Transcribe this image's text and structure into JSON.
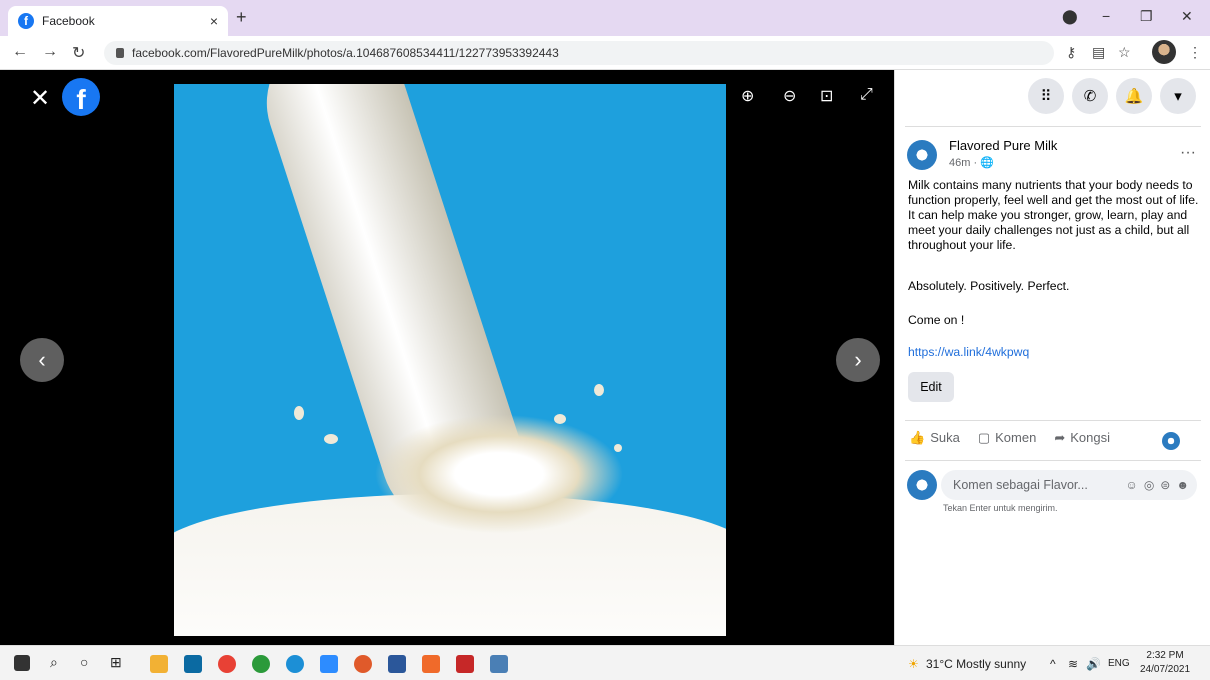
{
  "browser": {
    "tab_title": "Facebook",
    "tab_close": "×",
    "new_tab": "+",
    "url": "facebook.com/FlavoredPureMilk/photos/a.104687608534411/122773953392443",
    "window_minimize": "−",
    "window_restore": "❐",
    "window_close": "✕"
  },
  "viewer": {
    "close_label": "✕",
    "fb_logo": "f"
  },
  "panel": {
    "page_name": "Flavored Pure Milk",
    "time": "46m · 🌐",
    "more": "···",
    "text_1": "Milk contains many nutrients that your body needs to function properly, feel well and get the most out of life. It can help make you stronger, grow, learn, play and meet your daily challenges not just as a child, but all throughout your life.",
    "text_2": "Absolutely. Positively. Perfect.",
    "text_3": "Come on !",
    "link": "https://wa.link/4wkpwq",
    "edit_label": "Edit",
    "like_label": "Suka",
    "comment_label": "Komen",
    "share_label": "Kongsi",
    "comment_placeholder": "Komen sebagai Flavor...",
    "enter_hint": "Tekan Enter untuk mengirim."
  },
  "taskbar": {
    "weather": "31°C  Mostly sunny",
    "lang": "ENG",
    "time": "2:32 PM",
    "date": "24/07/2021"
  },
  "colors": {
    "facebook_blue": "#1877f2",
    "tab_strip": "#e5d9f2",
    "link": "#216fdb"
  }
}
